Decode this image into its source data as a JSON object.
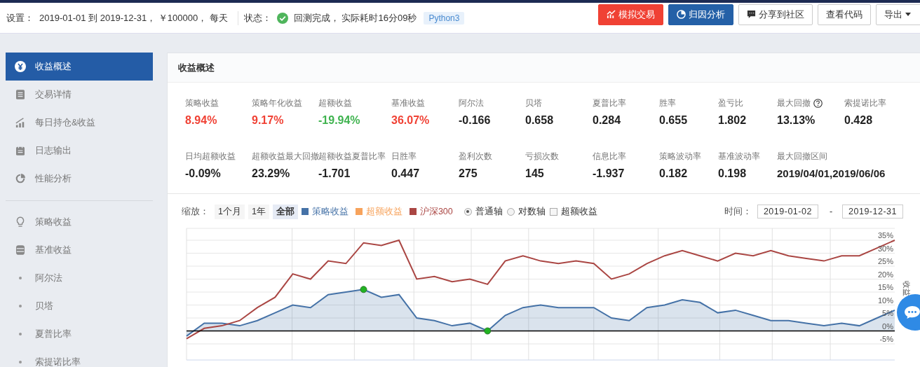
{
  "topbar": {
    "settings_label": "设置：",
    "settings": "2019-01-01 到 2019-12-31， ￥100000， 每天",
    "status_label": "状态：",
    "status": "回测完成， 实际耗时16分09秒",
    "done": true,
    "language": "Python3",
    "buttons": [
      {
        "label": "模拟交易",
        "kind": "red"
      },
      {
        "label": "归因分析",
        "kind": "blue"
      },
      {
        "label": "分享到社区",
        "kind": "plain"
      },
      {
        "label": "查看代码",
        "kind": "plain"
      },
      {
        "label": "导出",
        "kind": "menu"
      }
    ]
  },
  "sidebar": {
    "groups": [
      [
        {
          "label": "收益概述",
          "kind": "icon",
          "selected": true
        },
        {
          "label": "交易详情",
          "kind": "icon",
          "selected": false
        },
        {
          "label": "每日持仓&收益",
          "kind": "icon",
          "selected": false
        },
        {
          "label": "日志输出",
          "kind": "icon",
          "selected": false
        },
        {
          "label": "性能分析",
          "kind": "icon",
          "selected": false
        }
      ],
      [
        {
          "label": "策略收益",
          "kind": "icon",
          "selected": false
        },
        {
          "label": "基准收益",
          "kind": "icon",
          "selected": false
        },
        {
          "label": "阿尔法",
          "kind": "sub",
          "selected": false
        },
        {
          "label": "贝塔",
          "kind": "sub",
          "selected": false
        },
        {
          "label": "夏普比率",
          "kind": "sub",
          "selected": false
        },
        {
          "label": "索提诺比率",
          "kind": "sub",
          "selected": false
        }
      ]
    ]
  },
  "panel": {
    "title": "收益概述",
    "metrics": [
      {
        "label": "策略收益",
        "value": "8.94%",
        "color": "#f04134"
      },
      {
        "label": "策略年化收益",
        "value": "9.17%",
        "color": "#f04134"
      },
      {
        "label": "超额收益",
        "value": "-19.94%",
        "color": "#3fb34f"
      },
      {
        "label": "基准收益",
        "value": "36.07%",
        "color": "#f04134"
      },
      {
        "label": "阿尔法",
        "value": "-0.166"
      },
      {
        "label": "贝塔",
        "value": "0.658"
      },
      {
        "label": "夏普比率",
        "value": "0.284"
      },
      {
        "label": "胜率",
        "value": "0.655"
      },
      {
        "label": "盈亏比",
        "value": "1.802"
      },
      {
        "label": "最大回撤",
        "value": "13.13%",
        "help": true
      },
      {
        "label": "索提诺比率",
        "value": "0.428"
      },
      {
        "label": "日均超额收益",
        "value": "-0.09%"
      },
      {
        "label": "超额收益最大回撤",
        "value": "23.29%"
      },
      {
        "label": "超额收益夏普比率",
        "value": "-1.701"
      },
      {
        "label": "日胜率",
        "value": "0.447"
      },
      {
        "label": "盈利次数",
        "value": "275"
      },
      {
        "label": "亏损次数",
        "value": "145"
      },
      {
        "label": "信息比率",
        "value": "-1.937"
      },
      {
        "label": "策略波动率",
        "value": "0.182"
      },
      {
        "label": "基准波动率",
        "value": "0.198"
      },
      {
        "label": "最大回撤区间",
        "value": "2019/04/01,2019/06/06"
      }
    ],
    "zoom_label": "缩放：",
    "zoom": [
      {
        "label": "1个月",
        "selected": false
      },
      {
        "label": "1年",
        "selected": false
      },
      {
        "label": "全部",
        "selected": true
      }
    ],
    "legend_extra": {
      "label": "超额收益",
      "color": "#f7a35c"
    },
    "axis_modes": [
      {
        "label": "普通轴",
        "selected": true
      },
      {
        "label": "对数轴",
        "selected": false
      }
    ],
    "excess_toggle": {
      "label": "超额收益",
      "checked": false
    },
    "time_label": "时间：",
    "date_from": "2019-01-02",
    "date_sep": "-",
    "date_to": "2019-12-31",
    "chart_data": {
      "type": "line",
      "ylabel": "收益",
      "grid": true,
      "series": [
        {
          "name": "策略收益",
          "color": "#4572a7",
          "values": [
            -2,
            3,
            3,
            2,
            4,
            7,
            10,
            9,
            14,
            15,
            16,
            13,
            14,
            5,
            4,
            2,
            3,
            0,
            6,
            9,
            10,
            9,
            9,
            9,
            5,
            4,
            9,
            10,
            12,
            11,
            7,
            8,
            6,
            4,
            4,
            3,
            2,
            3,
            2,
            5,
            8
          ]
        },
        {
          "name": "沪深300",
          "color": "#aa4643",
          "values": [
            -3,
            1,
            2,
            4,
            9,
            13,
            22,
            20,
            27,
            26,
            34,
            33,
            35,
            20,
            21,
            19,
            20,
            18,
            27,
            29,
            27,
            26,
            27,
            26,
            20,
            22,
            26,
            29,
            31,
            29,
            27,
            30,
            29,
            31,
            29,
            28,
            27,
            29,
            29,
            32,
            35
          ]
        }
      ],
      "ylim": [
        -5,
        35
      ],
      "yticks": [
        {
          "value": -5,
          "label": "-5%"
        },
        {
          "value": 0,
          "label": "0%"
        },
        {
          "value": 5,
          "label": "5%"
        },
        {
          "value": 10,
          "label": "10%"
        },
        {
          "value": 15,
          "label": "15%"
        },
        {
          "value": 20,
          "label": "20%"
        },
        {
          "value": 25,
          "label": "25%"
        },
        {
          "value": 30,
          "label": "30%"
        },
        {
          "value": 35,
          "label": "35%"
        }
      ]
    }
  }
}
